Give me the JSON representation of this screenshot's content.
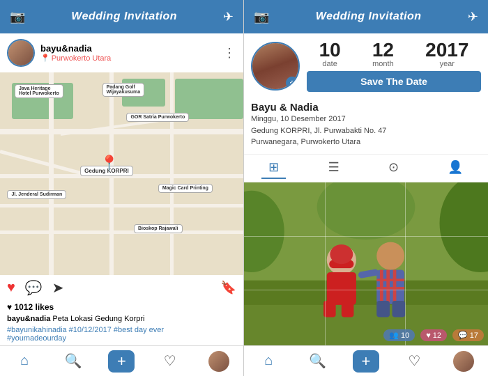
{
  "left": {
    "header": {
      "title": "Wedding Invitation",
      "camera_icon": "📷",
      "send_icon": "✈"
    },
    "profile": {
      "name": "bayu&nadia",
      "location": "Purwokerto Utara",
      "location_icon": "📍"
    },
    "actions": {
      "like_icon": "♥",
      "comment_icon": "💬",
      "share_icon": "✈",
      "bookmark_icon": "🔖"
    },
    "likes": "♥ 1012 likes",
    "caption_user": "bayu&nadia",
    "caption_text": " Peta Lokasi Gedung Korpri",
    "hashtags": "#bayunikahinadia #10/12/2017 #best day ever\n#youmadeourday",
    "nav": {
      "home": "⌂",
      "search": "🔍",
      "add": "+",
      "heart": "♡",
      "avatar": ""
    }
  },
  "right": {
    "header": {
      "title": "Wedding Invitation",
      "camera_icon": "📷",
      "send_icon": "✈"
    },
    "date": {
      "day_num": "10",
      "day_label": "date",
      "month_num": "12",
      "month_label": "month",
      "year_num": "2017",
      "year_label": "year"
    },
    "save_btn": "Save The Date",
    "event": {
      "names": "Bayu & Nadia",
      "line1": "Minggu, 10 Desember 2017",
      "line2": "Gedung KORPRI, Jl. Purwabakti No. 47",
      "line3": "Purwanegara, Purwokerto Utara"
    },
    "tabs": [
      "⊞",
      "☰",
      "⊙",
      "👤"
    ],
    "stats": [
      {
        "icon": "👥",
        "count": "10",
        "type": "people"
      },
      {
        "icon": "♥",
        "count": "12",
        "type": "likes"
      },
      {
        "icon": "💬",
        "count": "17",
        "type": "comments"
      }
    ],
    "nav": {
      "home": "⌂",
      "search": "🔍",
      "add": "+",
      "heart": "♡",
      "avatar": ""
    }
  }
}
